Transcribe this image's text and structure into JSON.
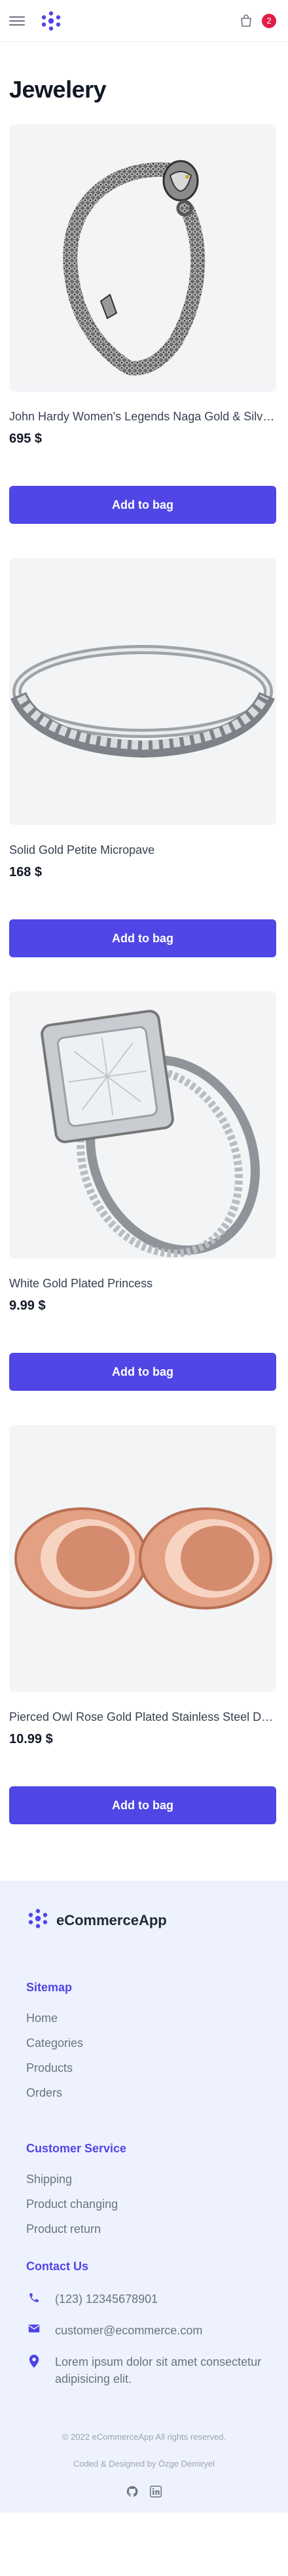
{
  "header": {
    "menu_icon": "hamburger-icon",
    "logo_icon": "flower-logo-icon",
    "bag_icon": "shopping-bag-icon",
    "bag_count": "2",
    "accent_color": "#4f46e5",
    "badge_color": "#e11d48"
  },
  "page": {
    "title": "Jewelery"
  },
  "products": [
    {
      "name": "John Hardy Women's Legends Naga Gold & Silver Dragon Station Chain Bracelet",
      "price": "695 $",
      "button": "Add to bag"
    },
    {
      "name": "Solid Gold Petite Micropave",
      "price": "168 $",
      "button": "Add to bag"
    },
    {
      "name": "White Gold Plated Princess",
      "price": "9.99 $",
      "button": "Add to bag"
    },
    {
      "name": "Pierced Owl Rose Gold Plated Stainless Steel Double Flared Tunnel Plug Earrings",
      "price": "10.99 $",
      "button": "Add to bag"
    }
  ],
  "footer": {
    "brand": "eCommerceApp",
    "sitemap_title": "Sitemap",
    "sitemap": [
      "Home",
      "Categories",
      "Products",
      "Orders"
    ],
    "service_title": "Customer Service",
    "service": [
      "Shipping",
      "Product changing",
      "Product return"
    ],
    "contact_title": "Contact Us",
    "phone": "(123) 12345678901",
    "email": "customer@ecommerce.com",
    "address": "Lorem ipsum dolor sit amet consectetur adipisicing elit.",
    "copyright": "© 2022 eCommerceApp All rights reserved.",
    "credit": "Coded & Designed by Özge Demiryel",
    "social": [
      "github-icon",
      "linkedin-icon"
    ]
  }
}
